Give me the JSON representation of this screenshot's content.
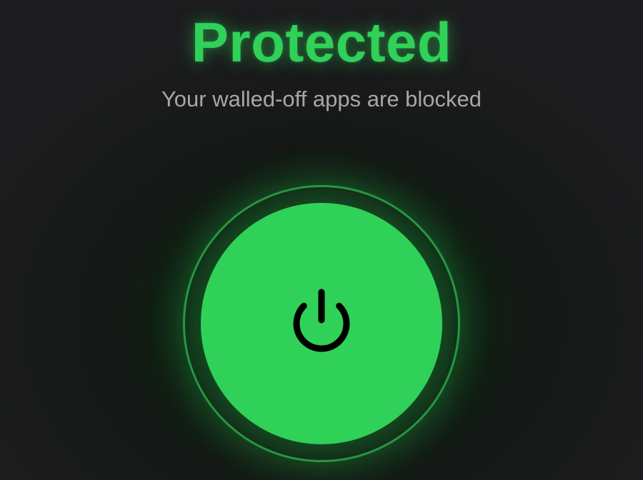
{
  "status": {
    "title": "Protected",
    "subtitle": "Your walled-off apps are blocked",
    "state_color": "#30d158"
  },
  "power_button": {
    "icon": "power-icon",
    "state": "on"
  },
  "theme": {
    "background": "#1c1c1e",
    "accent": "#30d158",
    "subtitle_color": "#a7a7aa",
    "icon_color": "#000000"
  }
}
